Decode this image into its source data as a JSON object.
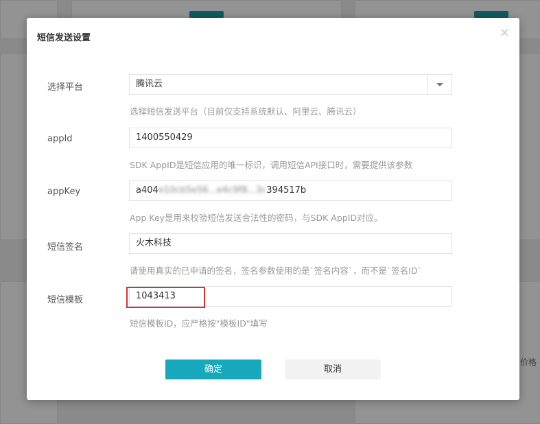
{
  "background": {
    "side_text": "价格"
  },
  "modal": {
    "title": "短信发送设置",
    "close_glyph": "×",
    "fields": {
      "platform": {
        "label": "选择平台",
        "value": "腾讯云",
        "hint": "选择短信发送平台（目前仅支持系统默认、阿里云、腾讯云）"
      },
      "appid": {
        "label": "appId",
        "value": "1400550429",
        "hint": "SDK AppID是短信应用的唯一标识，调用短信API接口时，需要提供该参数"
      },
      "appkey": {
        "label": "appKey",
        "value_start": "a404",
        "value_blurred": "e10cb5e56...e4c9f8...3c",
        "value_end": "394517b",
        "hint": "App Key是用来校验短信发送合法性的密码，与SDK AppID对应。"
      },
      "sign": {
        "label": "短信签名",
        "value": "火木科技",
        "hint": "请使用真实的已申请的签名，签名参数使用的是`签名内容`，而不是`签名ID`"
      },
      "template": {
        "label": "短信模板",
        "value": "1043413",
        "hint": "短信模板ID，应严格按\"模板ID\"填写"
      }
    },
    "buttons": {
      "confirm": "确定",
      "cancel": "取消"
    }
  },
  "colors": {
    "accent": "#17a9bb",
    "highlight": "#d9312c"
  }
}
